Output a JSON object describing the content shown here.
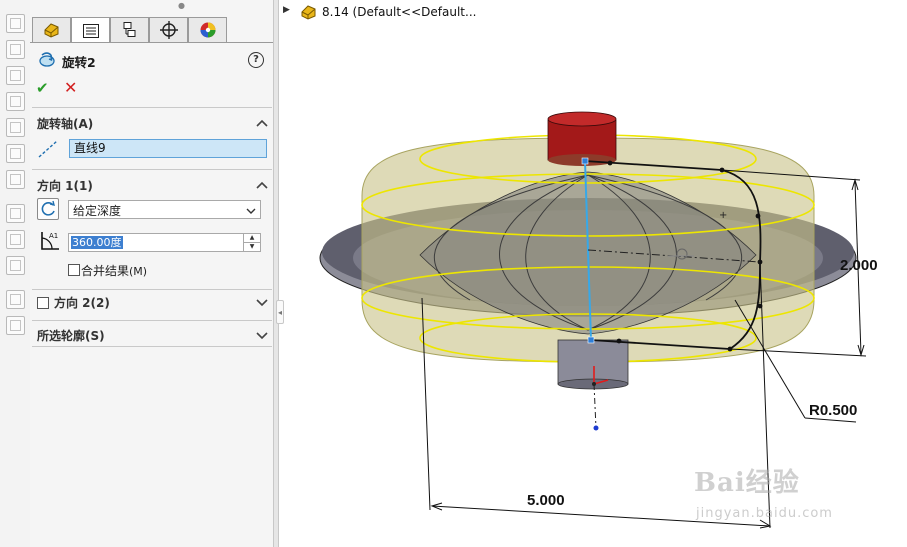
{
  "feature_manager": {
    "tabs": [
      {
        "icon": "feature-manager-icon",
        "active": false
      },
      {
        "icon": "property-manager-icon",
        "active": true
      },
      {
        "icon": "configuration-manager-icon",
        "active": false
      },
      {
        "icon": "dimxpert-manager-icon",
        "active": false
      },
      {
        "icon": "display-manager-icon",
        "active": false
      }
    ]
  },
  "panel": {
    "title": "旋转2",
    "help": "?",
    "ok": "✔",
    "cancel": "✕",
    "axis_section": {
      "title": "旋转轴(A)",
      "axis_value": "直线9"
    },
    "direction1": {
      "title": "方向 1(1)",
      "end_condition": "给定深度",
      "angle": "360.00度",
      "merge_label": "合并结果",
      "merge_key": "(M)",
      "merge_checked": false
    },
    "direction2": {
      "title": "方向 2(2)",
      "checked": false
    },
    "profile_section": {
      "title": "所选轮廓(S)"
    }
  },
  "graphics": {
    "tree_item": "8.14  (Default<<Default...",
    "dimensions": {
      "height": "2.000",
      "radius": "R0.500",
      "width": "5.000"
    },
    "watermark": "Bai经验",
    "watermark_url": "jingyan.baidu.com"
  },
  "colors": {
    "panel_bg": "#f5f5f5",
    "selected_field": "#cde6f7",
    "preview_yellow": "#e8e000",
    "preview_fill": "#c9c48a",
    "boss_red": "#b01c1c",
    "ok_green": "#2a9d2a",
    "cancel_red": "#d21f1f"
  }
}
